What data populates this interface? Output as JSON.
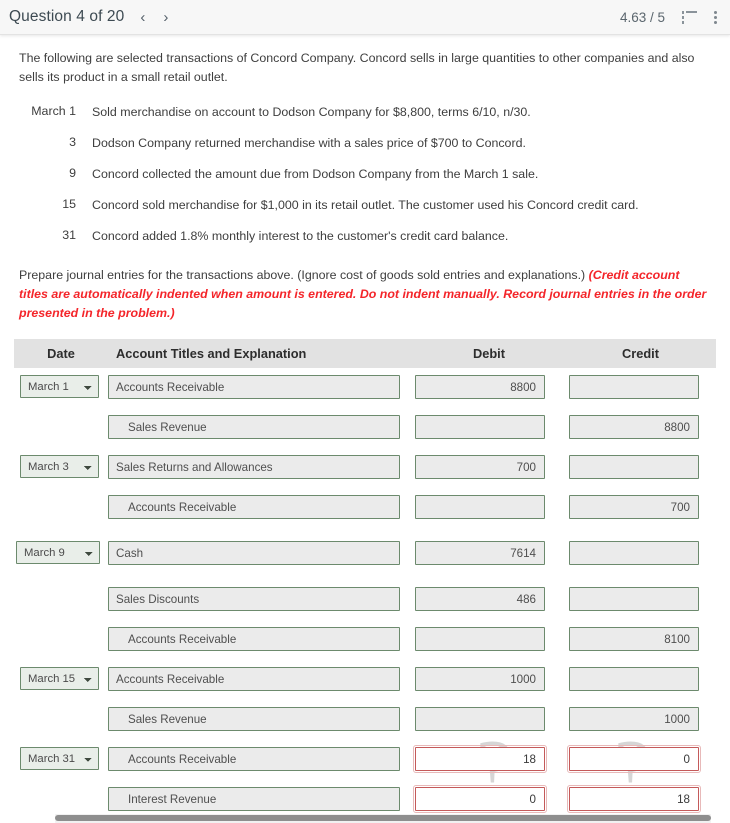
{
  "header": {
    "question_label": "Question 4 of 20",
    "prev_arrow": "‹",
    "next_arrow": "›",
    "score": "4.63 / 5",
    "list_icon_name": "list-icon",
    "menu_icon_name": "kebab-menu-icon"
  },
  "intro": "The following are selected transactions of Concord Company. Concord sells in large quantities to other companies and also sells its product in a small retail outlet.",
  "transactions": [
    {
      "date": "March 1",
      "desc": "Sold merchandise on account to Dodson Company for $8,800, terms 6/10, n/30."
    },
    {
      "date": "3",
      "desc": "Dodson Company returned merchandise with a sales price of $700 to Concord."
    },
    {
      "date": "9",
      "desc": "Concord collected the amount due from Dodson Company from the March 1 sale."
    },
    {
      "date": "15",
      "desc": "Concord sold merchandise for $1,000 in its retail outlet. The customer used his Concord credit card."
    },
    {
      "date": "31",
      "desc": "Concord added 1.8% monthly interest to the customer's credit card balance."
    }
  ],
  "prepare": {
    "normal": "Prepare journal entries for the transactions above. (Ignore cost of goods sold entries and explanations.) ",
    "emphasis": "(Credit account titles are automatically indented when amount is entered. Do not indent manually. Record journal entries in the order presented in the problem.)"
  },
  "journal": {
    "columns": {
      "date": "Date",
      "account": "Account Titles and Explanation",
      "debit": "Debit",
      "credit": "Credit"
    },
    "rows": [
      {
        "date": "March 1",
        "account": "Accounts Receivable",
        "indent": false,
        "debit": "8800",
        "credit": "",
        "error": false
      },
      {
        "date": "",
        "account": "Sales Revenue",
        "indent": true,
        "debit": "",
        "credit": "8800",
        "error": false
      },
      {
        "date": "March 3",
        "account": "Sales Returns and Allowances",
        "indent": false,
        "debit": "700",
        "credit": "",
        "error": false
      },
      {
        "date": "",
        "account": "Accounts Receivable",
        "indent": true,
        "debit": "",
        "credit": "700",
        "error": false
      },
      {
        "date": "March 9",
        "account": "Cash",
        "indent": false,
        "debit": "7614",
        "credit": "",
        "error": false
      },
      {
        "date": "",
        "account": "Sales Discounts",
        "indent": false,
        "debit": "486",
        "credit": "",
        "error": false
      },
      {
        "date": "",
        "account": "Accounts Receivable",
        "indent": true,
        "debit": "",
        "credit": "8100",
        "error": false
      },
      {
        "date": "March 15",
        "account": "Accounts Receivable",
        "indent": false,
        "debit": "1000",
        "credit": "",
        "error": false
      },
      {
        "date": "",
        "account": "Sales Revenue",
        "indent": true,
        "debit": "",
        "credit": "1000",
        "error": false
      },
      {
        "date": "March 31",
        "account": "Accounts Receivable",
        "indent": false,
        "debit": "18",
        "credit": "0",
        "error": true
      },
      {
        "date": "",
        "account": "Interest Revenue",
        "indent": true,
        "debit": "0",
        "credit": "18",
        "error": true
      }
    ],
    "date_options": [
      "March 1",
      "March 3",
      "March 9",
      "March 15",
      "March 31"
    ]
  },
  "watermark": {
    "glyph": "?"
  },
  "colors": {
    "field_border": "#6c8a6d",
    "field_bg": "#ebebeb",
    "error_border": "#c45a5a",
    "accent_red": "#f4252a",
    "header_bg": "#e2e2e2"
  }
}
